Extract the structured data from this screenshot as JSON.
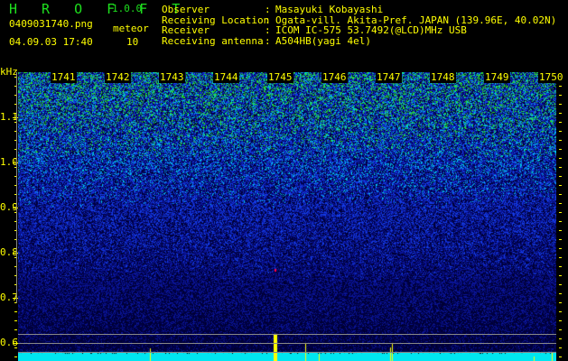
{
  "app": {
    "title": "H R O F F T",
    "version": "1.0.0"
  },
  "file": {
    "name": "0409031740.png",
    "datetime": "04.09.03 17:40"
  },
  "meteor": {
    "label": "meteor",
    "count": "10"
  },
  "info": [
    {
      "label": "Observer",
      "value": "Masayuki Kobayashi"
    },
    {
      "label": "Receiving Location",
      "value": "Ogata-vill. Akita-Pref. JAPAN (139.96E, 40.02N)"
    },
    {
      "label": "Receiver",
      "value": "ICOM IC-575 53.7492(@LCD)MHz USB"
    },
    {
      "label": "Receiving antenna",
      "value": "A504HB(yagi 4el)"
    }
  ],
  "spectrogram": {
    "y_unit": "kHz",
    "y_labels": [
      "1.1",
      "1.0",
      "0.9",
      "0.8",
      "0.7",
      "0.6"
    ],
    "time_labels": [
      "1741",
      "1742",
      "1743",
      "1744",
      "1745",
      "1746",
      "1747",
      "1748",
      "1749",
      "1750"
    ]
  }
}
